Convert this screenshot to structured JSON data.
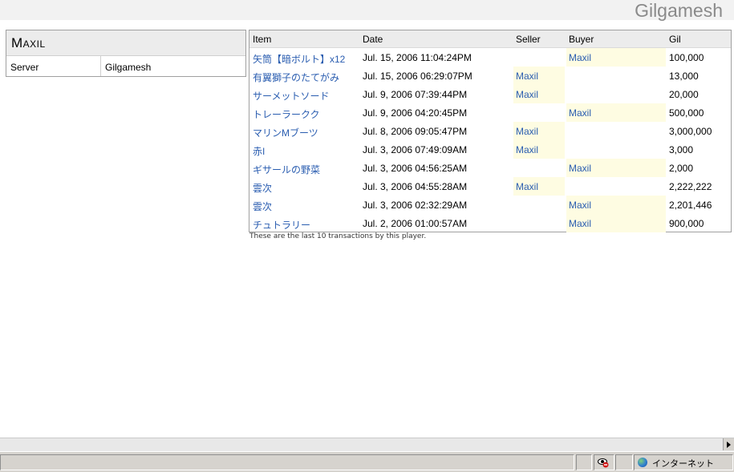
{
  "header": {
    "server_title": "Gilgamesh"
  },
  "profile": {
    "name": "Maxil",
    "rows": [
      {
        "label": "Server",
        "value": "Gilgamesh"
      }
    ]
  },
  "transactions": {
    "columns": [
      "Item",
      "Date",
      "Seller",
      "Buyer",
      "Gil"
    ],
    "rows": [
      {
        "item": "矢筒【暗ボルト】x12",
        "date": "Jul. 15, 2006 11:04:24PM",
        "seller": "",
        "buyer": "Maxil",
        "gil": "100,000"
      },
      {
        "item": "有翼獅子のたてがみ",
        "date": "Jul. 15, 2006 06:29:07PM",
        "seller": "Maxil",
        "buyer": "",
        "gil": "13,000"
      },
      {
        "item": "サーメットソード",
        "date": "Jul. 9, 2006 07:39:44PM",
        "seller": "Maxil",
        "buyer": "",
        "gil": "20,000"
      },
      {
        "item": "トレーラークク",
        "date": "Jul. 9, 2006 04:20:45PM",
        "seller": "",
        "buyer": "Maxil",
        "gil": "500,000"
      },
      {
        "item": "マリンMブーツ",
        "date": "Jul. 8, 2006 09:05:47PM",
        "seller": "Maxil",
        "buyer": "",
        "gil": "3,000,000"
      },
      {
        "item": "赤I",
        "date": "Jul. 3, 2006 07:49:09AM",
        "seller": "Maxil",
        "buyer": "",
        "gil": "3,000"
      },
      {
        "item": "ギサールの野菜",
        "date": "Jul. 3, 2006 04:56:25AM",
        "seller": "",
        "buyer": "Maxil",
        "gil": "2,000"
      },
      {
        "item": "雲次",
        "date": "Jul. 3, 2006 04:55:28AM",
        "seller": "Maxil",
        "buyer": "",
        "gil": "2,222,222"
      },
      {
        "item": "雲次",
        "date": "Jul. 3, 2006 02:32:29AM",
        "seller": "",
        "buyer": "Maxil",
        "gil": "2,201,446"
      },
      {
        "item": "チュトラリー",
        "date": "Jul. 2, 2006 01:00:57AM",
        "seller": "",
        "buyer": "Maxil",
        "gil": "900,000"
      }
    ],
    "footnote": "These are the last 10 transactions by this player.",
    "highlight_color": "#fefce2",
    "link_color": "#2a5db0"
  },
  "statusbar": {
    "zone": "インターネット",
    "zone_icon": "globe-icon",
    "privacy_icon": "privacy-eye-icon"
  }
}
